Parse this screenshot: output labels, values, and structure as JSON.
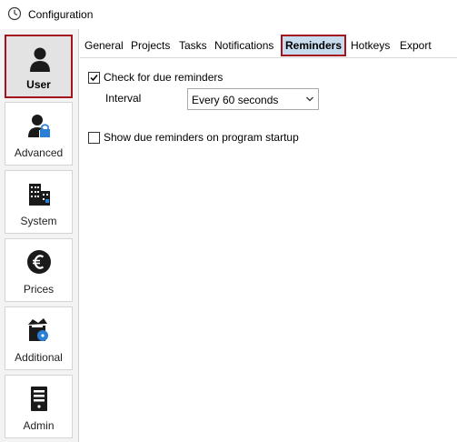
{
  "window": {
    "title": "Configuration"
  },
  "sidebar": {
    "items": [
      {
        "label": "User",
        "icon": "user-icon",
        "selected": true
      },
      {
        "label": "Advanced",
        "icon": "user-lock-icon",
        "selected": false
      },
      {
        "label": "System",
        "icon": "building-icon",
        "selected": false
      },
      {
        "label": "Prices",
        "icon": "euro-icon",
        "selected": false
      },
      {
        "label": "Additional",
        "icon": "box-disc-icon",
        "selected": false
      },
      {
        "label": "Admin",
        "icon": "server-icon",
        "selected": false
      }
    ]
  },
  "tabs": [
    {
      "label": "General",
      "active": false
    },
    {
      "label": "Projects",
      "active": false
    },
    {
      "label": "Tasks",
      "active": false
    },
    {
      "label": "Notifications",
      "active": false
    },
    {
      "label": "Reminders",
      "active": true
    },
    {
      "label": "Hotkeys",
      "active": false
    },
    {
      "label": "Export",
      "active": false
    }
  ],
  "reminders": {
    "check_due": {
      "label": "Check for due reminders",
      "checked": true
    },
    "interval": {
      "label": "Interval",
      "value": "Every 60 seconds"
    },
    "show_on_startup": {
      "label": "Show due reminders on program startup",
      "checked": false
    }
  },
  "colors": {
    "highlight_border": "#a4141f",
    "active_tab_bg": "#c8dcf0",
    "selected_item_bg": "#e3e3e3"
  }
}
